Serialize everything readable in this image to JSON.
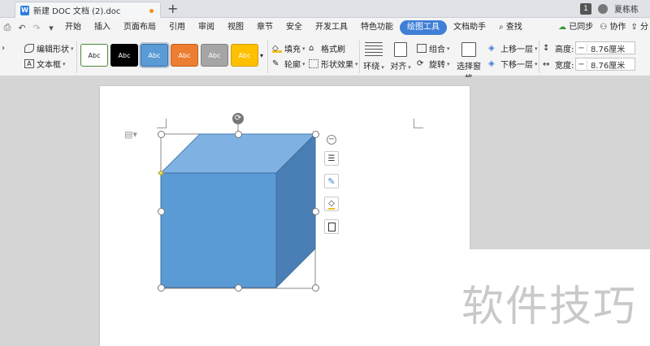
{
  "titlebar": {
    "tab_title": "新建 DOC 文档 (2).doc",
    "new_tab": "+",
    "page_badge": "1",
    "user_name": "夏栋栋"
  },
  "menubar": {
    "items": [
      "开始",
      "插入",
      "页面布局",
      "引用",
      "审阅",
      "视图",
      "章节",
      "安全",
      "开发工具",
      "特色功能",
      "绘图工具",
      "文档助手",
      "查找"
    ],
    "active": "绘图工具",
    "right": {
      "sync": "已同步",
      "collab": "协作",
      "share": "分"
    }
  },
  "ribbon": {
    "edit_shape": "编辑形状",
    "text_box": "文本框",
    "style_label": "Abc",
    "fill": "填充",
    "format_painter": "格式刷",
    "outline": "轮廓",
    "shape_effect": "形状效果",
    "wrap": "环绕",
    "align": "对齐",
    "group": "组合",
    "rotate": "旋转",
    "selection_pane": "选择窗格",
    "bring_forward": "上移一层",
    "send_backward": "下移一层",
    "height_label": "高度:",
    "width_label": "宽度:",
    "height_value": "8.76厘米",
    "width_value": "8.76厘米"
  },
  "styles": [
    {
      "bg": "#ffffff",
      "fg": "#222222",
      "border": "#4a8a3a"
    },
    {
      "bg": "#000000",
      "fg": "#ffffff",
      "border": "#000000"
    },
    {
      "bg": "#5b9bd5",
      "fg": "#ffffff",
      "border": "#3a6fa8"
    },
    {
      "bg": "#ed7d31",
      "fg": "#ffffff",
      "border": "#c25f1a"
    },
    {
      "bg": "#a5a5a5",
      "fg": "#ffffff",
      "border": "#7f7f7f"
    },
    {
      "bg": "#ffc000",
      "fg": "#ffffff",
      "border": "#d49f00"
    }
  ],
  "colors": {
    "cube_front": "#5b9bd5",
    "cube_top": "#7fb1e2",
    "cube_side": "#4a7fb5",
    "accent": "#3f7fd6"
  },
  "watermark": "软件技巧",
  "icons": [
    "doc-icon",
    "user-icon",
    "search-icon",
    "cloud-sync-icon",
    "collab-icon",
    "rotate-handle-icon",
    "minus-icon",
    "text-wrap-icon",
    "pen-icon",
    "fill-bucket-icon",
    "frame-icon",
    "page-icon"
  ]
}
